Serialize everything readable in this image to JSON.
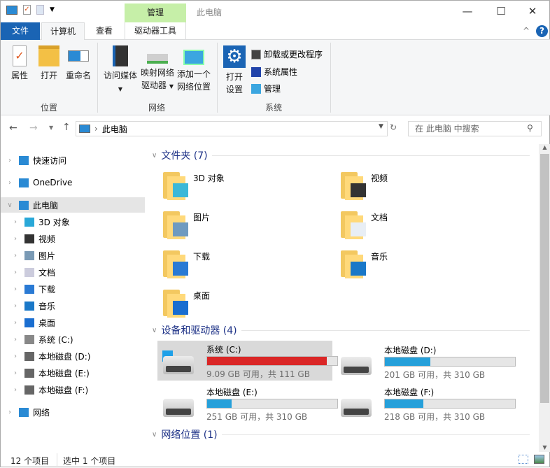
{
  "window": {
    "title": "此电脑",
    "contextual_tab": "管理",
    "min": "—",
    "max": "☐",
    "close": "✕"
  },
  "tabs": {
    "file": "文件",
    "computer": "计算机",
    "view": "查看",
    "drive_tools": "驱动器工具"
  },
  "ribbon": {
    "location": {
      "label": "位置",
      "properties": "属性",
      "open": "打开",
      "rename": "重命名"
    },
    "network": {
      "label": "网络",
      "media": "访问媒体",
      "map1": "映射网络",
      "map2": "驱动器",
      "add1": "添加一个",
      "add2": "网络位置"
    },
    "system": {
      "label": "系统",
      "settings1": "打开",
      "settings2": "设置",
      "uninstall": "卸载或更改程序",
      "sysprops": "系统属性",
      "manage": "管理"
    }
  },
  "address": {
    "path": "此电脑",
    "search_placeholder": "在 此电脑 中搜索"
  },
  "sidebar": {
    "items": [
      {
        "label": "快速访问"
      },
      {
        "label": "OneDrive"
      },
      {
        "label": "此电脑"
      },
      {
        "label": "3D 对象"
      },
      {
        "label": "视频"
      },
      {
        "label": "图片"
      },
      {
        "label": "文档"
      },
      {
        "label": "下载"
      },
      {
        "label": "音乐"
      },
      {
        "label": "桌面"
      },
      {
        "label": "系统 (C:)"
      },
      {
        "label": "本地磁盘 (D:)"
      },
      {
        "label": "本地磁盘 (E:)"
      },
      {
        "label": "本地磁盘 (F:)"
      },
      {
        "label": "网络"
      }
    ]
  },
  "main": {
    "folders_header": "文件夹 (7)",
    "folders": [
      {
        "name": "3D 对象"
      },
      {
        "name": "视频"
      },
      {
        "name": "图片"
      },
      {
        "name": "文档"
      },
      {
        "name": "下载"
      },
      {
        "name": "音乐"
      },
      {
        "name": "桌面"
      }
    ],
    "drives_header": "设备和驱动器 (4)",
    "drives": [
      {
        "name": "系统 (C:)",
        "caption": "9.09 GB 可用，共 111 GB",
        "used_fraction": 0.918,
        "color": "#da2626"
      },
      {
        "name": "本地磁盘 (D:)",
        "caption": "201 GB 可用，共 310 GB",
        "used_fraction": 0.352,
        "color": "#26a0da"
      },
      {
        "name": "本地磁盘 (E:)",
        "caption": "251 GB 可用，共 310 GB",
        "used_fraction": 0.19,
        "color": "#26a0da"
      },
      {
        "name": "本地磁盘 (F:)",
        "caption": "218 GB 可用，共 310 GB",
        "used_fraction": 0.297,
        "color": "#26a0da"
      }
    ],
    "network_header": "网络位置 (1)"
  },
  "status": {
    "count": "12 个项目",
    "selected": "选中 1 个项目"
  }
}
